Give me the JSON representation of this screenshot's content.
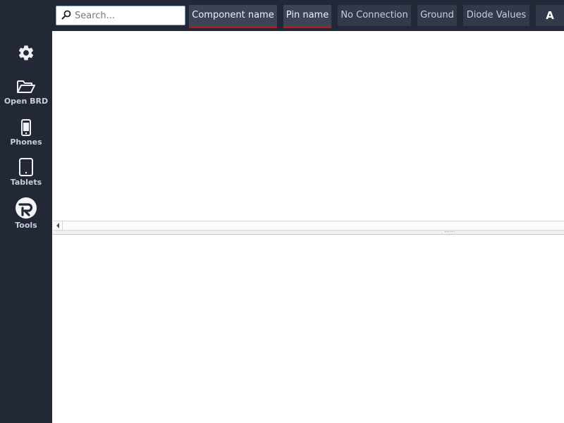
{
  "sidebar": {
    "items": [
      {
        "icon": "gear-icon",
        "label": ""
      },
      {
        "icon": "folder-open-icon",
        "label": "Open BRD"
      },
      {
        "icon": "phone-icon",
        "label": "Phones"
      },
      {
        "icon": "tablet-icon",
        "label": "Tablets"
      },
      {
        "icon": "r-logo-icon",
        "label": "Tools"
      }
    ]
  },
  "toolbar": {
    "search": {
      "placeholder": "Search...",
      "value": ""
    },
    "filters": [
      {
        "label": "Component name",
        "active": true
      },
      {
        "label": "Pin name",
        "active": true
      },
      {
        "label": "No Connection",
        "active": false
      },
      {
        "label": "Ground",
        "active": false
      },
      {
        "label": "Diode Values",
        "active": false
      }
    ],
    "font_button": "A"
  },
  "colors": {
    "sidebar_bg": "#222836",
    "button_bg": "#323a49",
    "active_underline": "#c0121a"
  }
}
